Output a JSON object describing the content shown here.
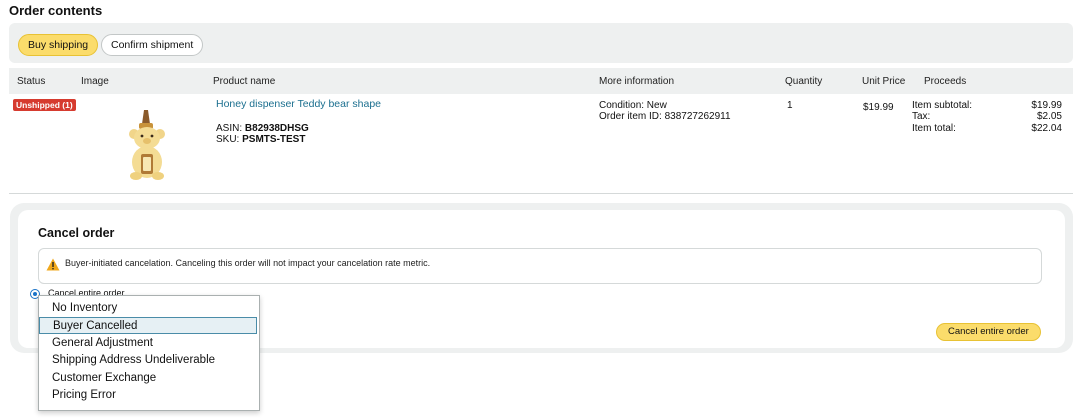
{
  "section_title": "Order contents",
  "toolbar": {
    "buy_shipping": "Buy shipping",
    "confirm_shipment": "Confirm shipment"
  },
  "table": {
    "headers": [
      "Status",
      "Image",
      "Product name",
      "More information",
      "Quantity",
      "Unit Price",
      "Proceeds"
    ],
    "row": {
      "status": "Unshipped (1)",
      "product_name": "Honey dispenser Teddy bear shape",
      "asin_label": "ASIN:",
      "asin": "B82938DHSG",
      "sku_label": "SKU:",
      "sku": "PSMTS-TEST",
      "condition": "Condition: New",
      "order_item_id": "Order item ID: 838727262911",
      "quantity": "1",
      "unit_price": "$19.99",
      "proceeds": [
        {
          "label": "Item subtotal:",
          "value": "$19.99"
        },
        {
          "label": "Tax:",
          "value": "$2.05"
        },
        {
          "label": "Item total:",
          "value": "$22.04"
        }
      ]
    }
  },
  "cancel": {
    "title": "Cancel order",
    "notice": "Buyer-initiated cancelation. Canceling this order will not impact your cancelation rate metric.",
    "radio_label": "Cancel entire order",
    "button": "Cancel entire order"
  },
  "dropdown": {
    "options": [
      "No Inventory",
      "Buyer Cancelled",
      "General Adjustment",
      "Shipping Address Undeliverable",
      "Customer Exchange",
      "Pricing Error"
    ],
    "selected": "Buyer Cancelled"
  },
  "colors": {
    "accent_yellow": "#fbdc6b",
    "badge_red": "#d63b2f",
    "link_blue": "#1b6f8f"
  }
}
